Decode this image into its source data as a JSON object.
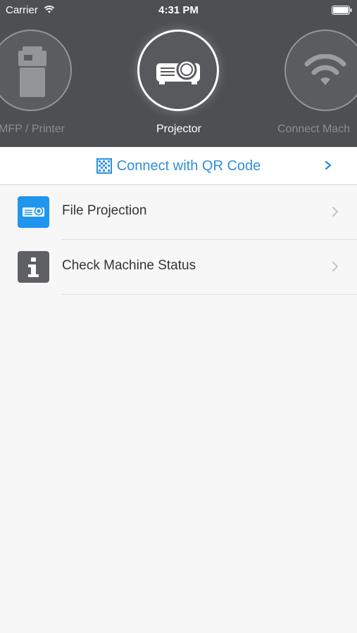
{
  "status_bar": {
    "carrier": "Carrier",
    "time": "4:31 PM"
  },
  "modes": [
    {
      "label": "MFP / Printer",
      "icon": "printer-icon",
      "active": false
    },
    {
      "label": "Projector",
      "icon": "projector-icon",
      "active": true
    },
    {
      "label": "Connect Mach",
      "icon": "wifi-icon",
      "active": false
    }
  ],
  "qr": {
    "label": "Connect with QR Code",
    "icon": "qr-code-icon"
  },
  "menu": [
    {
      "label": "File Projection",
      "icon": "projector-icon",
      "icon_color": "#1f95ee"
    },
    {
      "label": "Check Machine Status",
      "icon": "info-icon",
      "icon_color": "#5f6063"
    }
  ],
  "colors": {
    "header_bg": "#4d4f52",
    "accent": "#2e8fe0",
    "page_bg": "#f7f7f7"
  }
}
